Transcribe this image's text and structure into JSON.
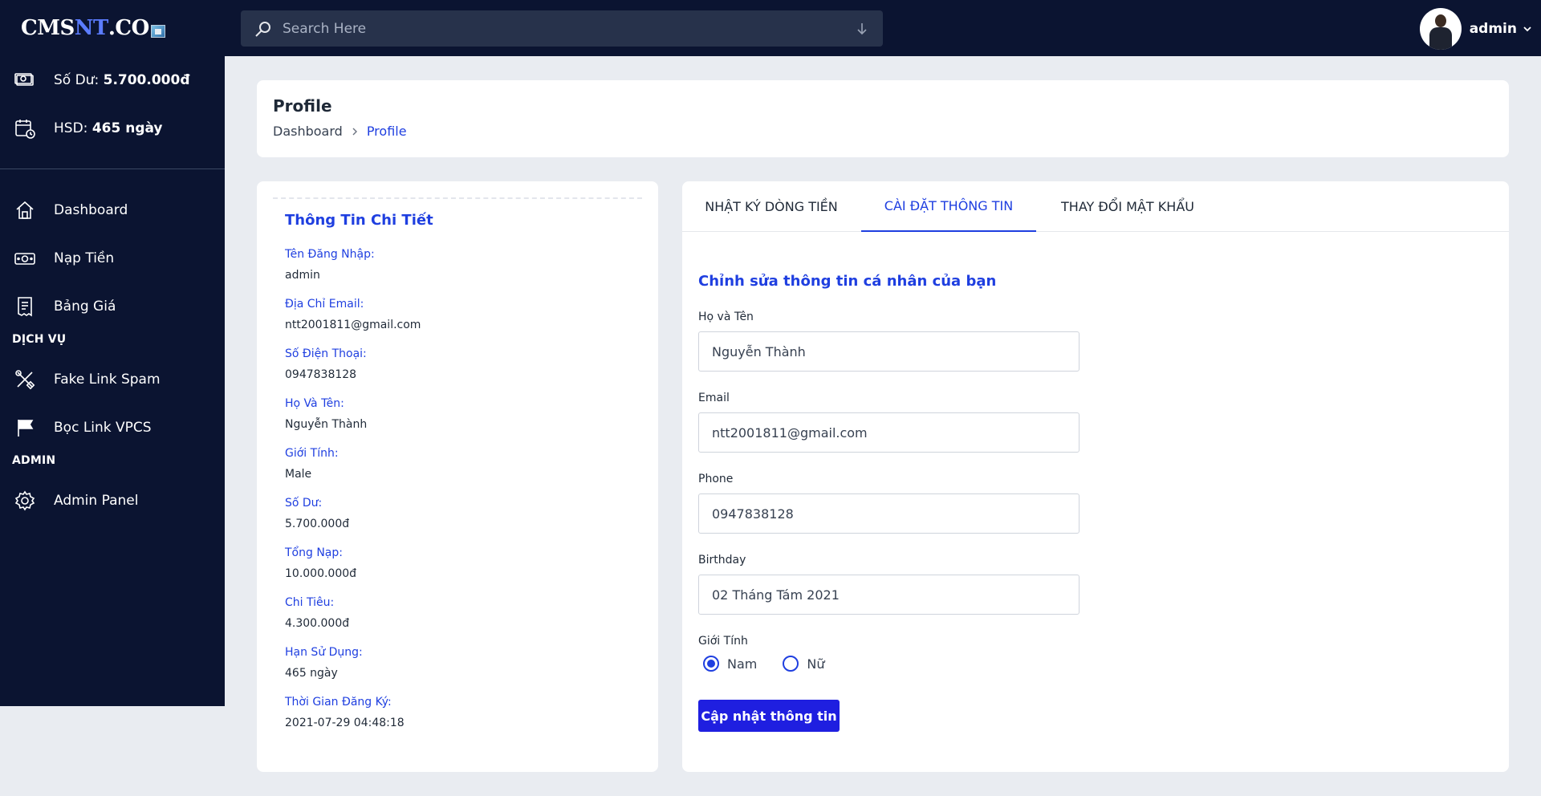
{
  "logo": {
    "part1": "CMS",
    "part2": "NT",
    "part3": ".CO"
  },
  "search": {
    "placeholder": "Search Here"
  },
  "user": {
    "name": "admin"
  },
  "sidebar": {
    "balance_label": "Số Dư:",
    "balance_value": "5.700.000đ",
    "expiry_label": "HSD:",
    "expiry_value": "465 ngày",
    "items": [
      {
        "label": "Dashboard",
        "icon": "home-icon"
      },
      {
        "label": "Nạp Tiền",
        "icon": "money-icon"
      },
      {
        "label": "Bảng Giá",
        "icon": "receipt-icon"
      }
    ],
    "section_services": "DỊCH VỤ",
    "service_items": [
      {
        "label": "Fake Link Spam",
        "icon": "tools-icon"
      },
      {
        "label": "Bọc Link VPCS",
        "icon": "flag-icon"
      }
    ],
    "section_admin": "ADMIN",
    "admin_items": [
      {
        "label": "Admin Panel",
        "icon": "gear-icon"
      }
    ]
  },
  "header": {
    "title": "Profile",
    "breadcrumb": [
      "Dashboard",
      "Profile"
    ]
  },
  "detail": {
    "title": "Thông Tin Chi Tiết",
    "fields": [
      {
        "label": "Tên Đăng Nhập:",
        "value": "admin"
      },
      {
        "label": "Địa Chỉ Email:",
        "value": "ntt2001811@gmail.com"
      },
      {
        "label": "Số Điện Thoại:",
        "value": "0947838128"
      },
      {
        "label": "Họ Và Tên:",
        "value": "Nguyễn Thành"
      },
      {
        "label": "Giới Tính:",
        "value": "Male"
      },
      {
        "label": "Số Dư:",
        "value": "5.700.000đ"
      },
      {
        "label": "Tổng Nạp:",
        "value": "10.000.000đ"
      },
      {
        "label": "Chi Tiêu:",
        "value": "4.300.000đ"
      },
      {
        "label": "Hạn Sử Dụng:",
        "value": "465 ngày"
      },
      {
        "label": "Thời Gian Đăng Ký:",
        "value": "2021-07-29 04:48:18"
      }
    ]
  },
  "tabs": [
    {
      "label": "NHẬT KÝ DÒNG TIỀN",
      "active": false
    },
    {
      "label": "CÀI ĐẶT THÔNG TIN",
      "active": true
    },
    {
      "label": "THAY ĐỔI MẬT KHẨU",
      "active": false
    }
  ],
  "form": {
    "title": "Chỉnh sửa thông tin cá nhân của bạn",
    "name_label": "Họ và Tên",
    "name_value": "Nguyễn Thành",
    "email_label": "Email",
    "email_value": "ntt2001811@gmail.com",
    "phone_label": "Phone",
    "phone_value": "0947838128",
    "birthday_label": "Birthday",
    "birthday_value": "02 Tháng Tám 2021",
    "gender_label": "Giới Tính",
    "gender_options": [
      "Nam",
      "Nữ"
    ],
    "gender_selected": "Nam",
    "submit_label": "Cập nhật thông tin"
  },
  "colors": {
    "sidebar_bg": "#0b1431",
    "accent": "#1f3fe0",
    "button": "#1f1fe0",
    "page_bg": "#e9ecf1"
  }
}
